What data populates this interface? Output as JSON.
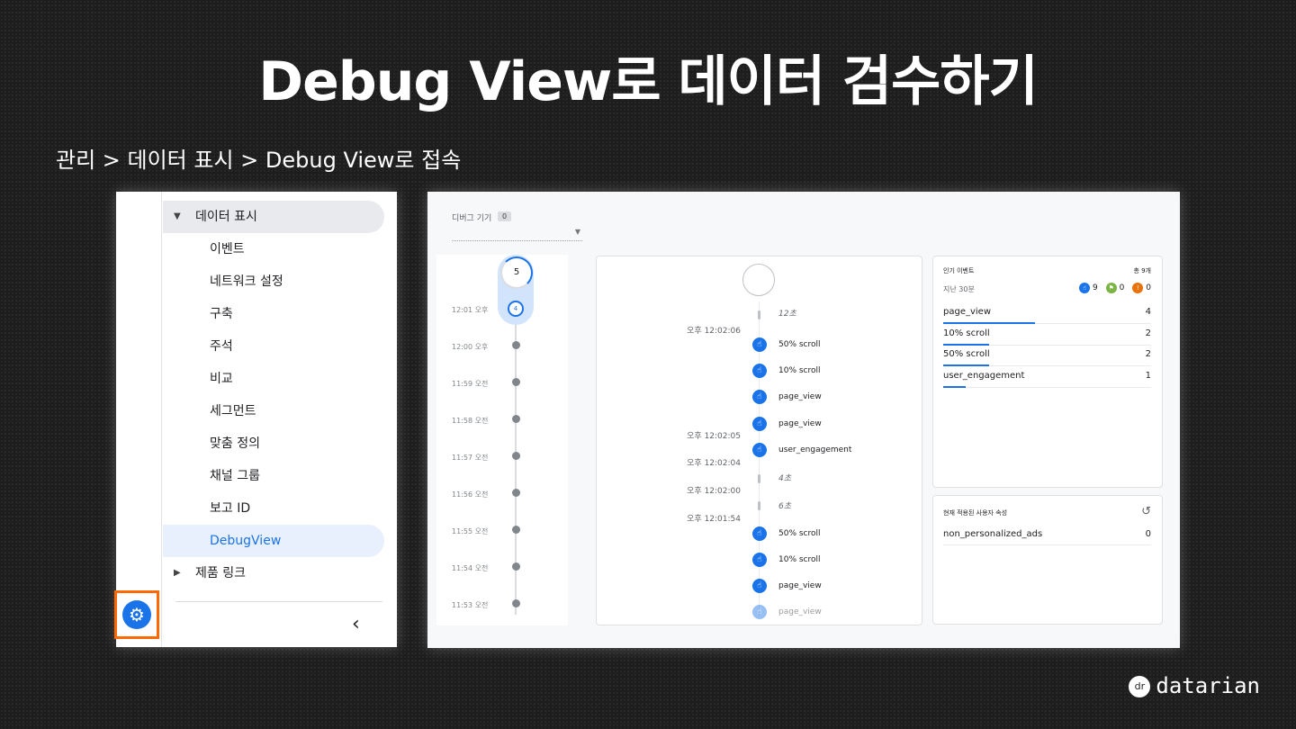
{
  "title": "Debug View로 데이터 검수하기",
  "breadcrumb": "관리 > 데이터 표시 > Debug View로 접속",
  "nav": {
    "section_label": "데이터 표시",
    "items": [
      "이벤트",
      "네트워크 설정",
      "구축",
      "주석",
      "비교",
      "세그먼트",
      "맞춤 정의",
      "채널 그룹",
      "보고 ID",
      "DebugView"
    ],
    "active_item": "DebugView",
    "product_links": "제품 링크",
    "collapse_icon": "chevron-left-icon",
    "settings_icon": "gear-icon",
    "highlight_color": "#ff6a00"
  },
  "debug": {
    "device_label": "디버그 기기",
    "device_count": "0",
    "minutes": {
      "top_count": "5",
      "current_count": "4",
      "times": [
        "12:01 오후",
        "12:00 오후",
        "11:59 오전",
        "11:58 오전",
        "11:57 오전",
        "11:56 오전",
        "11:55 오전",
        "11:54 오전",
        "11:53 오전"
      ]
    },
    "seconds": {
      "gaps": [
        "12초",
        "4초",
        "6초"
      ],
      "times": [
        "오후 12:02:06",
        "오후 12:02:05",
        "오후 12:02:04",
        "오후 12:02:00",
        "오후 12:01:54"
      ],
      "events": [
        "50% scroll",
        "10% scroll",
        "page_view",
        "page_view",
        "user_engagement",
        "50% scroll",
        "10% scroll",
        "page_view",
        "page_view"
      ]
    },
    "top_events": {
      "title": "인기 이벤트",
      "total": "총 9개",
      "period": "지난 30분",
      "counts": {
        "events": "9",
        "conversions": "0",
        "errors": "0"
      },
      "rows": [
        {
          "name": "page_view",
          "value": "4",
          "share": 0.44
        },
        {
          "name": "10% scroll",
          "value": "2",
          "share": 0.22
        },
        {
          "name": "50% scroll",
          "value": "2",
          "share": 0.22
        },
        {
          "name": "user_engagement",
          "value": "1",
          "share": 0.11
        }
      ]
    },
    "user_props": {
      "title": "현재 적용된 사용자 속성",
      "icon": "history-icon",
      "rows": [
        {
          "name": "non_personalized_ads",
          "value": "0"
        }
      ]
    },
    "accent_color": "#1a73e8"
  },
  "brand": {
    "badge": "dr",
    "name": "datarian"
  }
}
